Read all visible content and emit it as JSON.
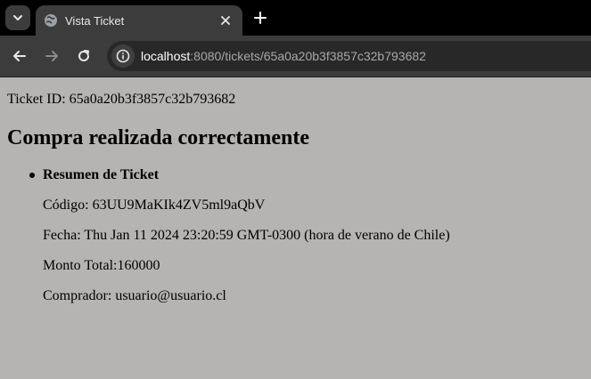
{
  "browser": {
    "tab": {
      "title": "Vista Ticket"
    },
    "address_bar": {
      "host": "localhost",
      "rest": ":8080/tickets/65a0a20b3f3857c32b793682"
    }
  },
  "page": {
    "ticket_id_line": "Ticket ID: 65a0a20b3f3857c32b793682",
    "heading": "Compra realizada correctamente",
    "summary": {
      "title": "Resumen de Ticket",
      "code": "Código: 63UU9MaKIk4ZV5ml9aQbV",
      "date": "Fecha: Thu Jan 11 2024 23:20:59 GMT-0300 (hora de verano de Chile)",
      "total": "Monto Total:160000",
      "buyer": "Comprador: usuario@usuario.cl"
    }
  },
  "colors": {
    "page_background": "#b6b4b2",
    "tabstrip": "#000000",
    "toolbar": "#3c3c3c",
    "omnibox": "#282828"
  },
  "icons": [
    "chevron-down-icon",
    "globe-icon",
    "close-icon",
    "plus-icon",
    "back-arrow-icon",
    "forward-arrow-icon",
    "reload-icon",
    "site-info-icon"
  ]
}
